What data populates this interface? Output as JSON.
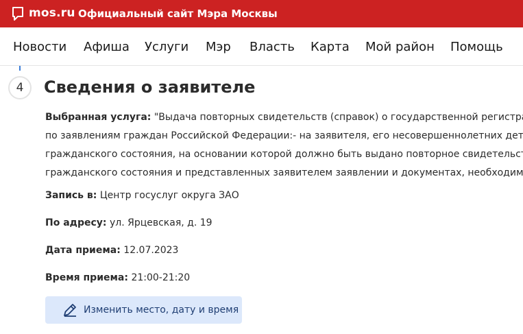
{
  "header": {
    "logo_text": "mos.ru",
    "site_title": "Официальный сайт Мэра Москвы",
    "logo_icon": "speech-bubble-icon",
    "brand_color": "#cc2222"
  },
  "nav": {
    "items": [
      "Новости",
      "Афиша",
      "Услуги",
      "Мэр",
      "Власть",
      "Карта",
      "Мой район",
      "Помощь"
    ]
  },
  "step": {
    "number": "4",
    "title": "Сведения о заявителе"
  },
  "service": {
    "label": "Выбранная услуга:",
    "lines": [
      "\"Выдача повторных свидетельств (справок) о государственной регистрации акто",
      "по заявлениям граждан Российской Федерации:- на заявителя, его несовершеннолетних детей (в сл",
      "гражданского состояния, на основании которой должно быть выдано повторное свидетельство (спр",
      "гражданского состояния и представленных заявителем заявлении и документах, необходимых для"
    ]
  },
  "details": {
    "record": {
      "label": "Запись в:",
      "value": "Центр госуслуг округа ЗАО"
    },
    "address": {
      "label": "По адресу:",
      "value": "ул. Ярцевская, д. 19"
    },
    "date": {
      "label": "Дата приема:",
      "value": "12.07.2023"
    },
    "time": {
      "label": "Время приема:",
      "value": "21:00-21:20"
    }
  },
  "actions": {
    "change_label": "Изменить место, дату и время",
    "change_icon": "pencil-icon",
    "button_bg": "#dce8fb"
  }
}
